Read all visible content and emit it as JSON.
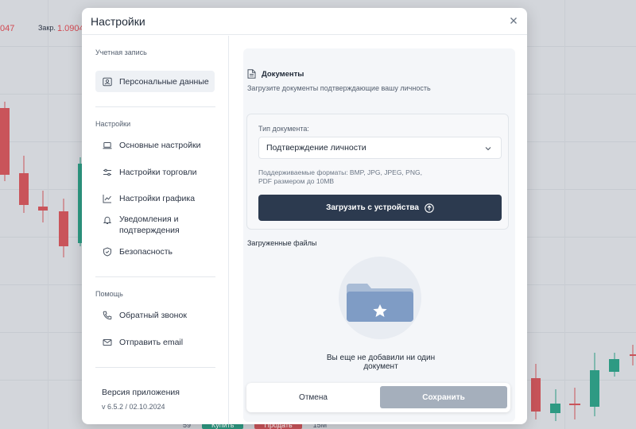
{
  "background": {
    "price_left": "047",
    "close_label": "Закр.",
    "close_value": "1.0904",
    "bottom_bar": {
      "zoom": "59",
      "buy_label": "Купить",
      "sell_label": "Продать",
      "period": "15M"
    }
  },
  "modal": {
    "title": "Настройки",
    "close_icon": "close-icon"
  },
  "sidebar": {
    "account_section": "Учетная запись",
    "account_items": [
      {
        "label": "Персональные данные",
        "icon": "person-card-icon"
      }
    ],
    "settings_section": "Настройки",
    "settings_items": [
      {
        "label": "Основные настройки",
        "icon": "laptop-icon"
      },
      {
        "label": "Настройки торговли",
        "icon": "sliders-icon"
      },
      {
        "label": "Настройки графика",
        "icon": "chart-line-icon"
      },
      {
        "label": "Уведомления и подтверждения",
        "icon": "bell-icon"
      },
      {
        "label": "Безопасность",
        "icon": "shield-icon"
      }
    ],
    "help_section": "Помощь",
    "help_items": [
      {
        "label": "Обратный звонок",
        "icon": "phone-icon"
      },
      {
        "label": "Отправить email",
        "icon": "mail-icon"
      }
    ],
    "version_label": "Версия приложения",
    "version_value": "v 6.5.2 / 02.10.2024"
  },
  "documents": {
    "title": "Документы",
    "subtitle": "Загрузите документы подтверждающие вашу личность",
    "type_label": "Тип документа:",
    "type_value": "Подтверждение личности",
    "formats_text": "Поддерживаемые форматы: BMP, JPG, JPEG, PNG, PDF размером до 10MB",
    "upload_button": "Загрузить с устройства",
    "uploaded_title": "Загруженные файлы",
    "empty_text": "Вы еще не добавили ни один документ",
    "cancel_button": "Отмена",
    "save_button": "Сохранить"
  },
  "colors": {
    "primary_button": "#2c3a4f",
    "save_disabled": "#a5afbc",
    "candle_up": "#2e9a83",
    "candle_down": "#c9545a"
  }
}
